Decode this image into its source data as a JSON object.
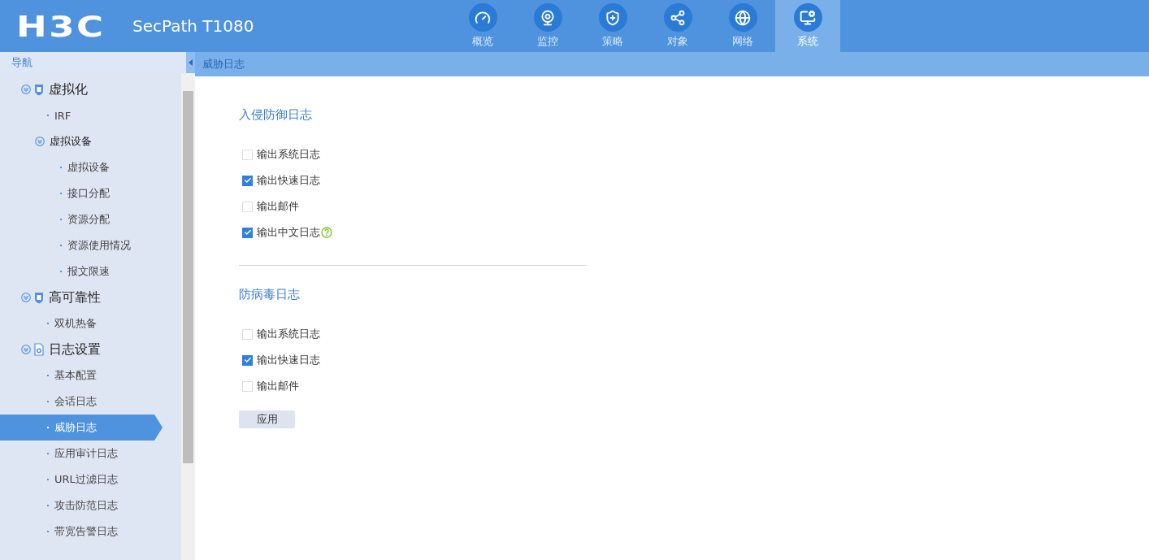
{
  "header": {
    "logo": "H3C",
    "product": "SecPath T1080"
  },
  "tabs": [
    {
      "label": "概览",
      "selected": false
    },
    {
      "label": "监控",
      "selected": false
    },
    {
      "label": "策略",
      "selected": false
    },
    {
      "label": "对象",
      "selected": false
    },
    {
      "label": "网络",
      "selected": false
    },
    {
      "label": "系统",
      "selected": true
    }
  ],
  "sidebar": {
    "title": "导航",
    "items": [
      {
        "label": "虚拟化",
        "expanded": true,
        "children": [
          {
            "label": "IRF",
            "selected": false
          },
          {
            "label": "虚拟设备",
            "expanded": true,
            "children": [
              {
                "label": "虚拟设备",
                "selected": false
              },
              {
                "label": "接口分配",
                "selected": false
              },
              {
                "label": "资源分配",
                "selected": false
              },
              {
                "label": "资源使用情况",
                "selected": false
              },
              {
                "label": "报文限速",
                "selected": false
              }
            ]
          }
        ]
      },
      {
        "label": "高可靠性",
        "expanded": true,
        "children": [
          {
            "label": "双机热备",
            "selected": false
          }
        ]
      },
      {
        "label": "日志设置",
        "expanded": true,
        "children": [
          {
            "label": "基本配置",
            "selected": false
          },
          {
            "label": "会话日志",
            "selected": false
          },
          {
            "label": "威胁日志",
            "selected": true
          },
          {
            "label": "应用审计日志",
            "selected": false
          },
          {
            "label": "URL过滤日志",
            "selected": false
          },
          {
            "label": "攻击防范日志",
            "selected": false
          },
          {
            "label": "带宽告警日志",
            "selected": false
          }
        ]
      }
    ]
  },
  "breadcrumb": "威胁日志",
  "sections": [
    {
      "title": "入侵防御日志",
      "options": [
        {
          "label": "输出系统日志",
          "checked": false,
          "help": false
        },
        {
          "label": "输出快速日志",
          "checked": true,
          "help": false
        },
        {
          "label": "输出邮件",
          "checked": false,
          "help": false
        },
        {
          "label": "输出中文日志",
          "checked": true,
          "help": true
        }
      ]
    },
    {
      "title": "防病毒日志",
      "options": [
        {
          "label": "输出系统日志",
          "checked": false,
          "help": false
        },
        {
          "label": "输出快速日志",
          "checked": true,
          "help": false
        },
        {
          "label": "输出邮件",
          "checked": false,
          "help": false
        }
      ]
    }
  ],
  "apply_button": "应用"
}
